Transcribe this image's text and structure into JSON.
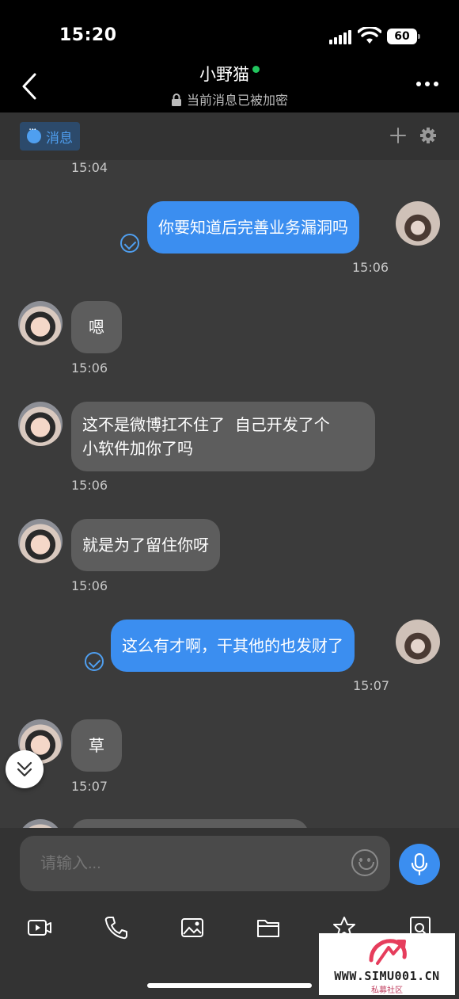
{
  "status_bar": {
    "time": "15:20",
    "battery": "60"
  },
  "header": {
    "title": "小野猫",
    "subtitle": "当前消息已被加密"
  },
  "tabs": {
    "messages_label": "消息"
  },
  "messages": [
    {
      "side": "in",
      "time": "15:04"
    },
    {
      "side": "out",
      "text": "你要知道后完善业务漏洞吗",
      "time": "15:06",
      "read": true
    },
    {
      "side": "in",
      "text": "嗯",
      "time": "15:06"
    },
    {
      "side": "in",
      "line1": "这不是微博扛不住了  自己开发了个",
      "line2": "小软件加你了吗",
      "time": "15:06"
    },
    {
      "side": "in",
      "text": "就是为了留住你呀",
      "time": "15:06"
    },
    {
      "side": "out",
      "text": "这么有才啊，干其他的也发财了",
      "time": "15:07",
      "read": true
    },
    {
      "side": "in",
      "text": "草",
      "time": "15:07"
    }
  ],
  "composer": {
    "placeholder": "请输入..."
  },
  "toolbar_icons": [
    "video-icon",
    "phone-icon",
    "image-icon",
    "folder-icon",
    "star-icon",
    "search-file-icon"
  ],
  "watermark": {
    "text": "WWW.SIMU001.CN",
    "sub": "私募社区"
  },
  "colors": {
    "accent": "#3b8ef0",
    "incoming_bubble": "#5d5d5d",
    "background": "#3b3b3b",
    "online": "#22c55e"
  }
}
